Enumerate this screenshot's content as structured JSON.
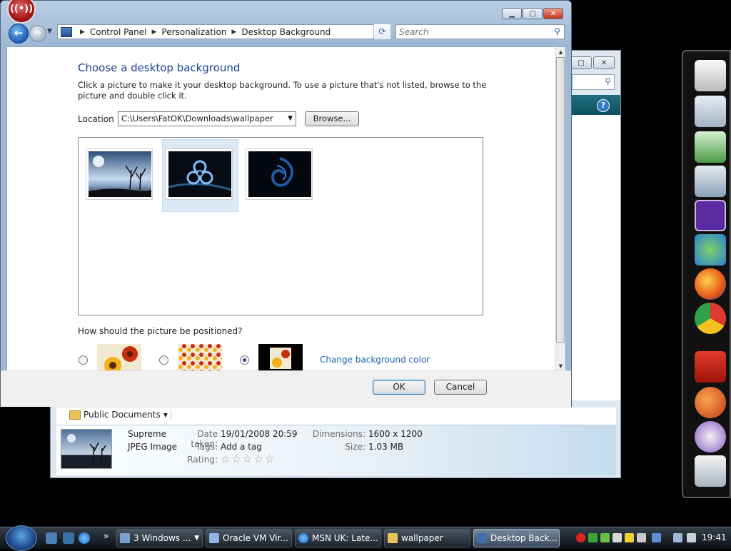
{
  "dialog": {
    "window_buttons": {
      "minimize": "▁",
      "maximize": "□",
      "close": "✕"
    },
    "breadcrumb": [
      "Control Panel",
      "Personalization",
      "Desktop Background"
    ],
    "search_placeholder": "Search",
    "heading": "Choose a desktop background",
    "description": "Click a picture to make it your desktop background. To use a picture that's not listed, browse to the picture and double click it.",
    "location_label": "Location",
    "location_value": "C:\\Users\\FatOK\\Downloads\\wallpaper",
    "browse_label": "Browse...",
    "wallpapers": [
      {
        "name": "wallpaper-winter-trees",
        "selected": false
      },
      {
        "name": "wallpaper-biohazard",
        "selected": true
      },
      {
        "name": "wallpaper-blue-swirl",
        "selected": false
      }
    ],
    "position_question": "How should the picture be positioned?",
    "position_options": [
      {
        "name": "fit-to-screen",
        "selected": false
      },
      {
        "name": "tile",
        "selected": false
      },
      {
        "name": "center",
        "selected": true
      }
    ],
    "change_color_link": "Change background color",
    "ok_label": "OK",
    "cancel_label": "Cancel"
  },
  "explorer": {
    "folder_label": "Public Documents",
    "file_name": "Supreme",
    "file_type": "JPEG Image",
    "date_taken_label": "Date taken:",
    "date_taken": "19/01/2008 20:59",
    "tags_label": "Tags:",
    "tags_value": "Add a tag",
    "rating_label": "Rating:",
    "rating_stars": "☆☆☆☆☆",
    "dimensions_label": "Dimensions:",
    "dimensions": "1600 x 1200",
    "size_label": "Size:",
    "size": "1.03 MB"
  },
  "taskbar": {
    "overflow": "»",
    "tasks": [
      {
        "label": "3 Windows ...",
        "icon": "windows-group-icon",
        "active": false
      },
      {
        "label": "Oracle VM Vir...",
        "icon": "virtualbox-icon",
        "active": false
      },
      {
        "label": "MSN UK: Late...",
        "icon": "ie-icon",
        "active": false
      },
      {
        "label": "wallpaper",
        "icon": "folder-icon",
        "active": false
      },
      {
        "label": "Desktop Back...",
        "icon": "control-panel-icon",
        "active": true
      }
    ],
    "clock": "19:41"
  },
  "dock_icons": [
    "monitor-icon",
    "folder-icon",
    "folder-icon",
    "folder-icon",
    "cpu-icon",
    "messenger-icon",
    "firefox-icon",
    "chrome-icon",
    "acrobat-icon",
    "pidgin-icon",
    "paint-icon",
    "recycle-bin-icon"
  ],
  "colors": {
    "accent": "#1c3f8a",
    "link": "#1e5fb3",
    "selection": "#dbe9f7"
  }
}
